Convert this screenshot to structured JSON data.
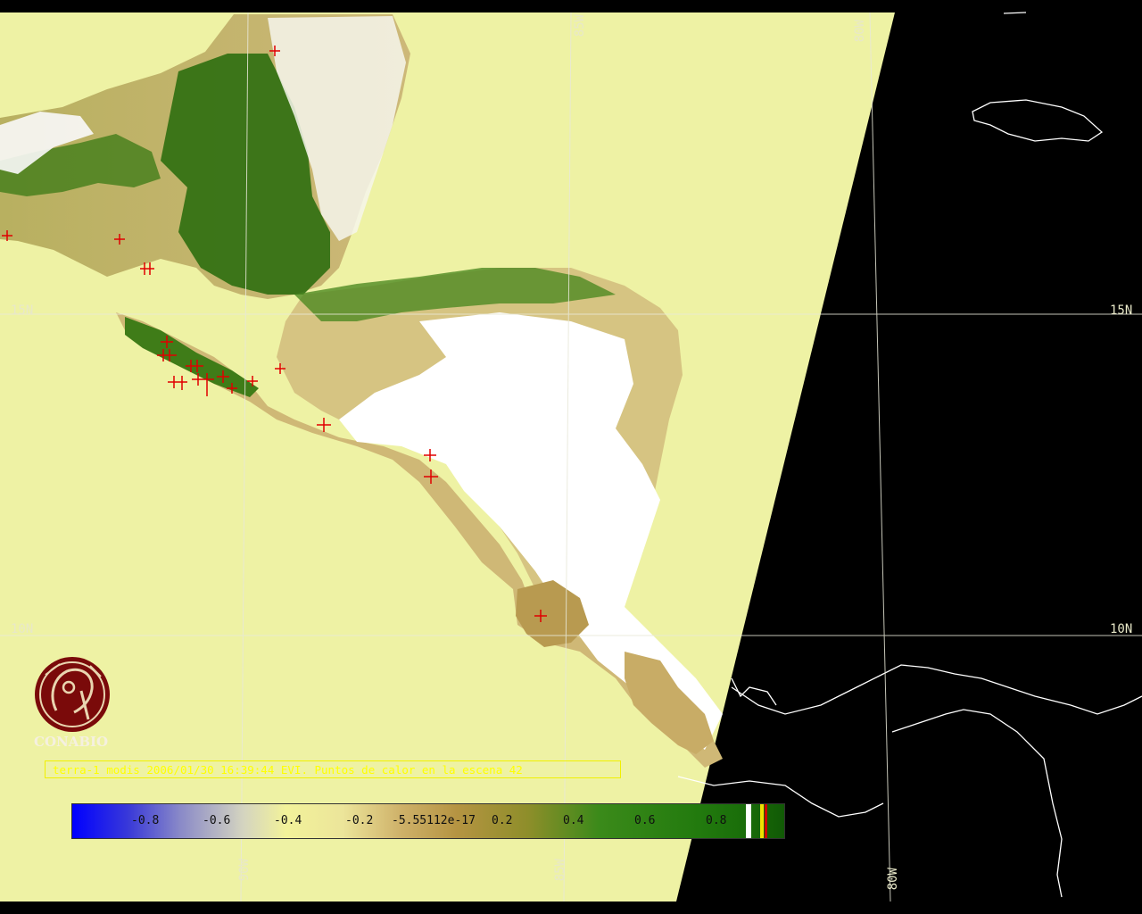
{
  "grid_labels": {
    "lat_15n_left": "15N",
    "lat_15n_right": "15N",
    "lat_10n_left": "10N",
    "lat_10n_right": "10N",
    "lon_85w_top": "85W",
    "lon_80w_top": "80W",
    "lon_90w_bottom": "90W",
    "lon_85w_bottom": "85W",
    "lon_80w_bottom": "80W"
  },
  "logo": {
    "text": "CONABIO",
    "color": "#7a0a0a"
  },
  "caption": "terra-1 modis 2006/01/30 16:39:44 EVI. Puntos de calor en la escena 42",
  "colorbar": {
    "ticks": [
      "-0.8",
      "-0.6",
      "-0.4",
      "-0.2",
      "-5.55112e-17",
      "0.2",
      "0.4",
      "0.6",
      "0.8"
    ],
    "colors": {
      "min": "#0000ff",
      "neutral": "#f2f29a",
      "max": "#115a05"
    }
  },
  "colors": {
    "background": "#000000",
    "ocean_swath": "#eef2a4",
    "land_low": "#d8c47a",
    "land_high": "#2d6e10",
    "cloud": "#ffffff",
    "hotspot": "#e00000",
    "caption": "#ffff00"
  }
}
